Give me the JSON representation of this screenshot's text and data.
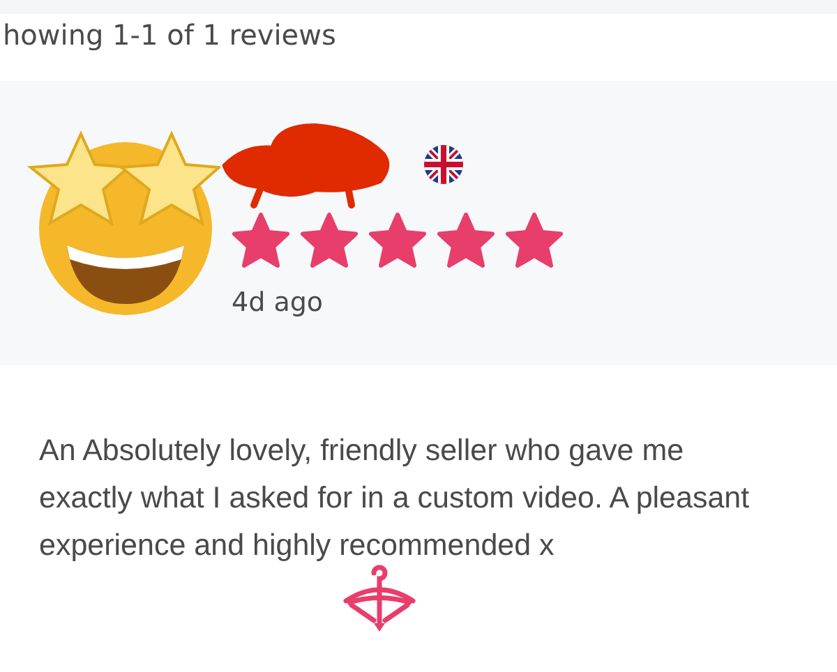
{
  "header": {
    "summary": "howing 1-1 of 1 reviews"
  },
  "review": {
    "stars": 5,
    "time": "4d ago",
    "text": "An Absolutely lovely, friendly seller who gave me exactly what I asked for in a custom video. A pleasant experience and highly recommended x"
  }
}
